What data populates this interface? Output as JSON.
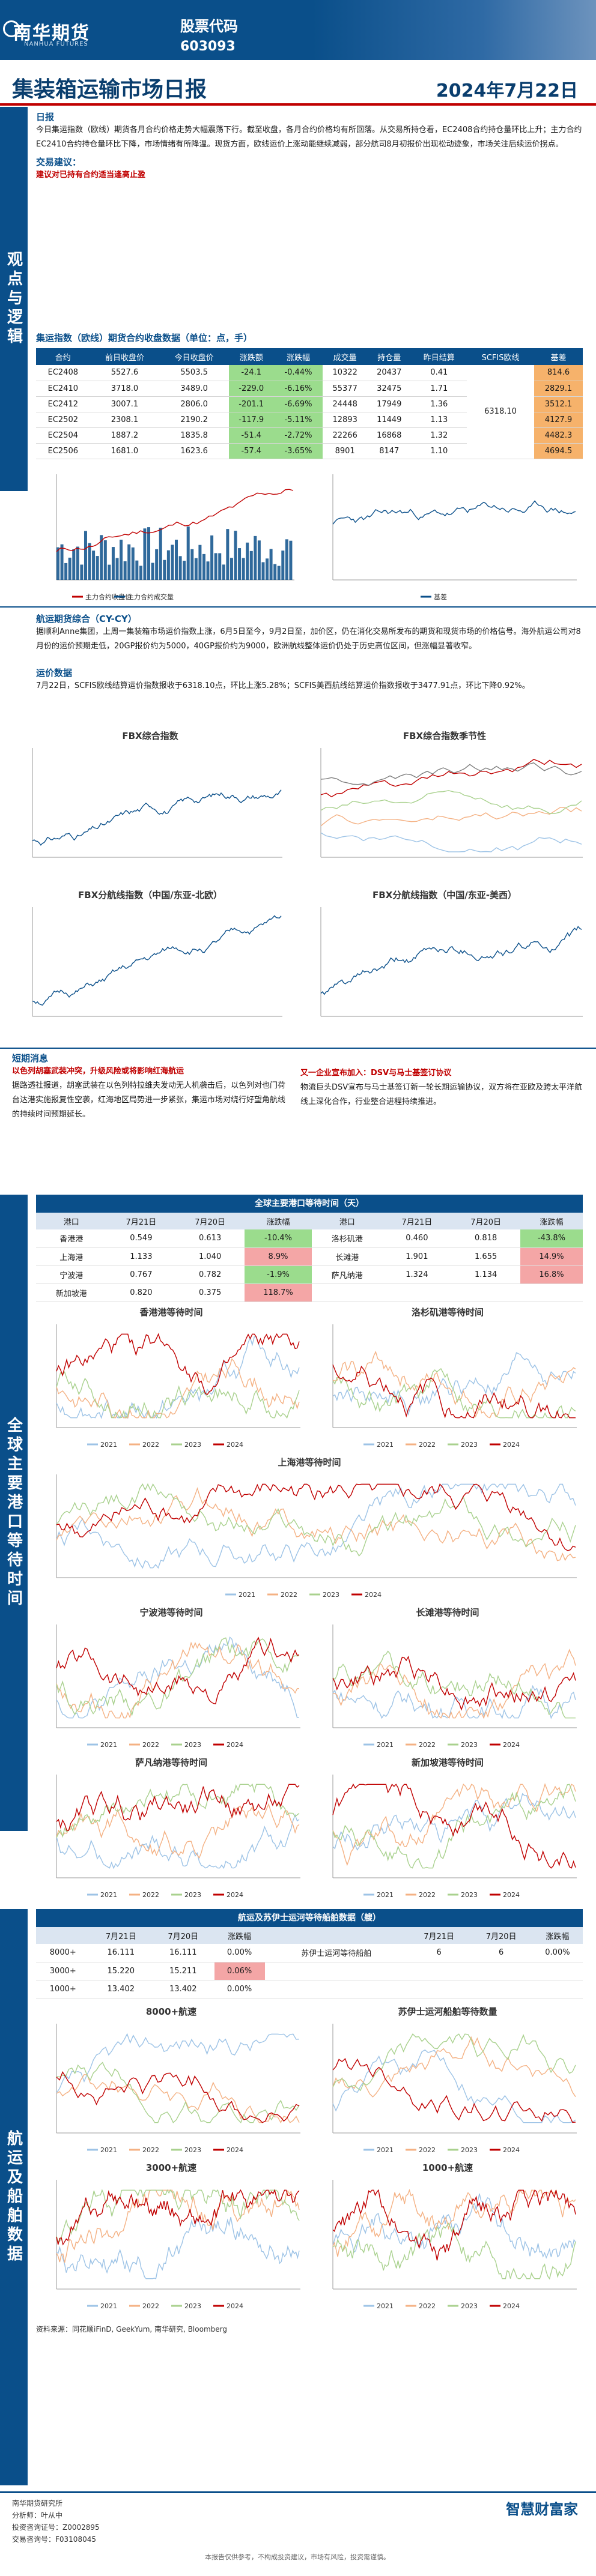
{
  "header": {
    "logo_cn": "南华期货",
    "logo_en": "NANHUA FUTURES",
    "code_label": "股票代码",
    "code": "603093"
  },
  "report": {
    "title": "集装箱运输市场日报",
    "date": "2024年7月22日"
  },
  "sections": {
    "view": "观点与逻辑",
    "freight": "全球主要港口等待时间",
    "route": "航运及船舶数据"
  },
  "summary": {
    "heading": "日报",
    "text": "今日集运指数（欧线）期货各月合约价格走势大幅震荡下行。截至收盘，各月合约价格均有所回落。从交易所持仓看，EC2408合约持仓量环比上升；主力合约EC2410合约持仓量环比下降，市场情绪有所降温。现货方面，欧线运价上涨动能继续减弱，部分航司8月初报价出现松动迹象，市场关注后续运价拐点。",
    "strategy_head": "交易建议：",
    "strategy": "建议对已持有合约适当逢高止盈"
  },
  "futures_table": {
    "caption": "集运指数（欧线）期货合约收盘数据（单位：点，手）",
    "headers": [
      "合约",
      "前日收盘价",
      "今日收盘价",
      "涨跌额",
      "涨跌幅",
      "成交量",
      "持仓量",
      "昨日结算",
      "SCFIS欧线",
      "基差"
    ],
    "rows": [
      [
        "EC2408",
        "5527.6",
        "5503.5",
        "-24.1",
        "-0.44%",
        "10322",
        "20437",
        "0.41",
        "",
        "814.6"
      ],
      [
        "EC2410",
        "3718.0",
        "3489.0",
        "-229.0",
        "-6.16%",
        "55377",
        "32475",
        "1.71",
        "",
        "2829.1"
      ],
      [
        "EC2412",
        "3007.1",
        "2806.0",
        "-201.1",
        "-6.69%",
        "24448",
        "17949",
        "1.36",
        "6318.10",
        "3512.1"
      ],
      [
        "EC2502",
        "2308.1",
        "2190.2",
        "-117.9",
        "-5.11%",
        "12893",
        "11449",
        "1.13",
        "",
        "4127.9"
      ],
      [
        "EC2504",
        "1887.2",
        "1835.8",
        "-51.4",
        "-2.72%",
        "22266",
        "16868",
        "1.32",
        "",
        "4482.3"
      ],
      [
        "EC2506",
        "1681.0",
        "1623.6",
        "-57.4",
        "-3.65%",
        "8901",
        "8147",
        "1.10",
        "",
        "4694.5"
      ]
    ]
  },
  "chart1": {
    "legend_a": "主力合约收盘价",
    "legend_b": "主力合约成交量"
  },
  "chart2": {
    "legend_a": "基差"
  },
  "cy_cy": {
    "heading": "航运期货综合（CY-CY）",
    "text": "据顺利Anne集团，上周一集装箱市场运价指数上涨，6月5日至今，9月2日至，加价区，仍在消化交易所发布的期货和现货市场的价格信号。海外航运公司对8月份的运价预期走低，20GP报价约为5000，40GP报价约为9000，欧洲航线整体运价仍处于历史高位区间，但涨幅显著收窄。"
  },
  "settlement": {
    "heading": "运价数据",
    "text": "7月22日，SCFIS欧线结算运价指数报收于6318.10点，环比上涨5.28%；SCFIS美西航线结算运价指数报收于3477.91点，环比下降0.92%。"
  },
  "fbx_charts": {
    "fbx": "FBX综合指数",
    "fbx_season": "FBX综合指数季节性",
    "fbx_cn_eu": "FBX分航线指数（中国/东亚-北欧）",
    "fbx_cn_us": "FBX分航线指数（中国/东亚-美西）"
  },
  "news": {
    "heading": "短期消息",
    "item1_title": "以色列胡塞武装冲突，升级风险或将影响红海航运",
    "item1": "据路透社报道，胡塞武装在以色列特拉维夫发动无人机袭击后，以色列对也门荷台达港实施报复性空袭，红海地区局势进一步紧张，集运市场对绕行好望角航线的持续时间预期延长。",
    "item2_title": "又一企业宣布加入：DSV与马士基签订协议",
    "item2": "物流巨头DSV宣布与马士基签订新一轮长期运输协议，双方将在亚欧及跨太平洋航线上深化合作，行业整合进程持续推进。"
  },
  "port_table": {
    "title": "全球主要港口等待时间（天）",
    "headers": [
      "港口",
      "7月21日",
      "7月20日",
      "涨跌幅",
      "港口",
      "7月21日",
      "7月20日",
      "涨跌幅"
    ],
    "rows": [
      [
        "香港港",
        "0.549",
        "0.613",
        "-10.4%",
        "洛杉矶港",
        "0.460",
        "0.818",
        "-43.8%"
      ],
      [
        "上海港",
        "1.133",
        "1.040",
        "8.9%",
        "长滩港",
        "1.901",
        "1.655",
        "14.9%"
      ],
      [
        "宁波港",
        "0.767",
        "0.782",
        "-1.9%",
        "萨凡纳港",
        "1.324",
        "1.134",
        "16.8%"
      ],
      [
        "新加坡港",
        "0.820",
        "0.375",
        "118.7%",
        "",
        "",
        "",
        ""
      ]
    ]
  },
  "port_charts": {
    "hk": "香港港等待时间",
    "la": "洛杉矶港等待时间",
    "sh": "上海港等待时间",
    "nb": "宁波港等待时间",
    "lb": "长滩港等待时间",
    "sv": "萨凡纳港等待时间",
    "sg": "新加坡港等待时间",
    "legend_2021": "2021",
    "legend_2022": "2022",
    "legend_2023": "2023",
    "legend_2024": "2024"
  },
  "ship_table": {
    "title": "航运及苏伊士运河等待船舶数据（艘）",
    "headers": [
      "",
      "7月21日",
      "7月20日",
      "涨跌幅",
      "",
      "7月21日",
      "7月20日",
      "涨跌幅"
    ],
    "rows": [
      [
        "8000+",
        "16.111",
        "16.111",
        "0.00%",
        "苏伊士运河等待船舶",
        "6",
        "6",
        "0.00%"
      ],
      [
        "3000+",
        "15.220",
        "15.211",
        "0.06%",
        "",
        "",
        "",
        ""
      ],
      [
        "1000+",
        "13.402",
        "13.402",
        "0.00%",
        "",
        "",
        "",
        ""
      ]
    ]
  },
  "ship_charts": {
    "c8000": "8000+航速",
    "suez": "苏伊士运河船舶等待数量",
    "c3000": "3000+航速",
    "c1000": "1000+航速"
  },
  "source": "资料来源：同花顺iFinD, GeekYum, 南华研究, Bloomberg",
  "footer": {
    "analyst": "南华期货研究所",
    "lines": [
      "分析师：叶从中",
      "投资咨询证号：Z0002895",
      "交易咨询号：F03108045"
    ],
    "brand": "智慧财富家",
    "disclaimer": "本报告仅供参考，不构成投资建议，市场有风险，投资需谨慎。"
  },
  "colors": {
    "brand": "#0a4f8a",
    "accent": "#c00000",
    "up": "#c00000",
    "down": "#2e8b57"
  }
}
